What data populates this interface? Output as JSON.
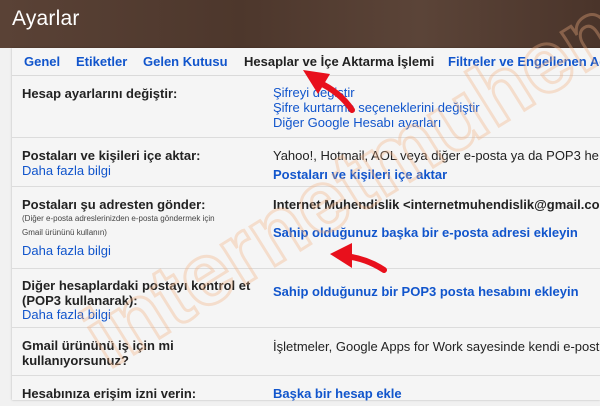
{
  "header": {
    "title": "Ayarlar"
  },
  "tabs": [
    {
      "label": "Genel"
    },
    {
      "label": "Etiketler"
    },
    {
      "label": "Gelen Kutusu"
    },
    {
      "label": "Hesaplar ve İçe Aktarma İşlemi"
    },
    {
      "label": "Filtreler ve Engellenen Adr"
    }
  ],
  "rows": {
    "change_account": {
      "label": "Hesap ayarlarını değiştir:",
      "links": [
        "Şifreyi değiştir",
        "Şifre kurtarma seçeneklerini değiştir",
        "Diğer Google Hesabı ayarları"
      ]
    },
    "import": {
      "label": "Postaları ve kişileri içe aktar:",
      "more": "Daha fazla bilgi",
      "desc": "Yahoo!, Hotmail, AOL veya diğer e-posta ya da POP3 he",
      "action": "Postaları ve kişileri içe aktar"
    },
    "send_as": {
      "label": "Postaları şu adresten gönder:",
      "note_line1": "(Diğer e-posta adreslerinizden e-posta göndermek için",
      "note_line2": "Gmail ürününü kullanın)",
      "more": "Daha fazla bilgi",
      "address": "Internet Muhendislik <internetmuhendislik@gmail.co",
      "action": "Sahip olduğunuz başka bir e-posta adresi ekleyin"
    },
    "pop3": {
      "label_line1": "Diğer hesaplardaki postayı kontrol et",
      "label_line2": "(POP3 kullanarak):",
      "more": "Daha fazla bilgi",
      "action": "Sahip olduğunuz bir POP3 posta hesabını ekleyin"
    },
    "work": {
      "label_line1": "Gmail ürününü iş için mi",
      "label_line2": "kullanıyorsunuz?",
      "desc": "İşletmeler, Google Apps for Work sayesinde kendi e-posta"
    },
    "grant": {
      "label": "Hesabınıza erişim izni verin:",
      "action": "Başka bir hesap ekle"
    }
  },
  "watermark": {
    "text": "internetmuhendisligi",
    "color": "#f4b183"
  },
  "colors": {
    "link": "#1155cc",
    "arrow": "#e8101c",
    "header_bg": "#52392d"
  }
}
